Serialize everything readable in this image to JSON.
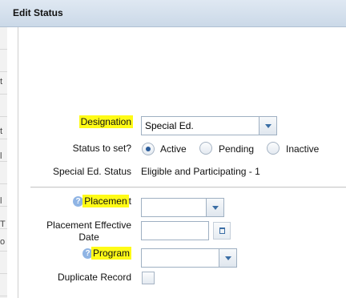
{
  "window": {
    "title": "Edit Status"
  },
  "background_fragments": [
    "t",
    "t",
    "l",
    "l",
    "T",
    "o"
  ],
  "form": {
    "designation": {
      "label": "Designation",
      "value": "Special Ed."
    },
    "status_to_set": {
      "label": "Status to set?",
      "options": [
        "Active",
        "Pending",
        "Inactive"
      ],
      "selected": "Active"
    },
    "special_ed_status": {
      "label": "Special Ed. Status",
      "value": "Eligible and Participating - 1"
    },
    "placement": {
      "label_highlight": "Placemen",
      "label_tail": "t",
      "value": ""
    },
    "placement_effective_date": {
      "label_line1": "Placement Effective",
      "label_line2": "Date",
      "value": ""
    },
    "program": {
      "label": "Program",
      "value": ""
    },
    "duplicate_record": {
      "label": "Duplicate Record",
      "checked": false
    }
  },
  "colors": {
    "highlight": "#fffb17",
    "titlebar": "#cbd9e8",
    "accent": "#3b6ea5",
    "help_icon": "#8fb4e4"
  },
  "icons": [
    "help-icon",
    "calendar-icon",
    "dropdown-arrow-icon"
  ]
}
